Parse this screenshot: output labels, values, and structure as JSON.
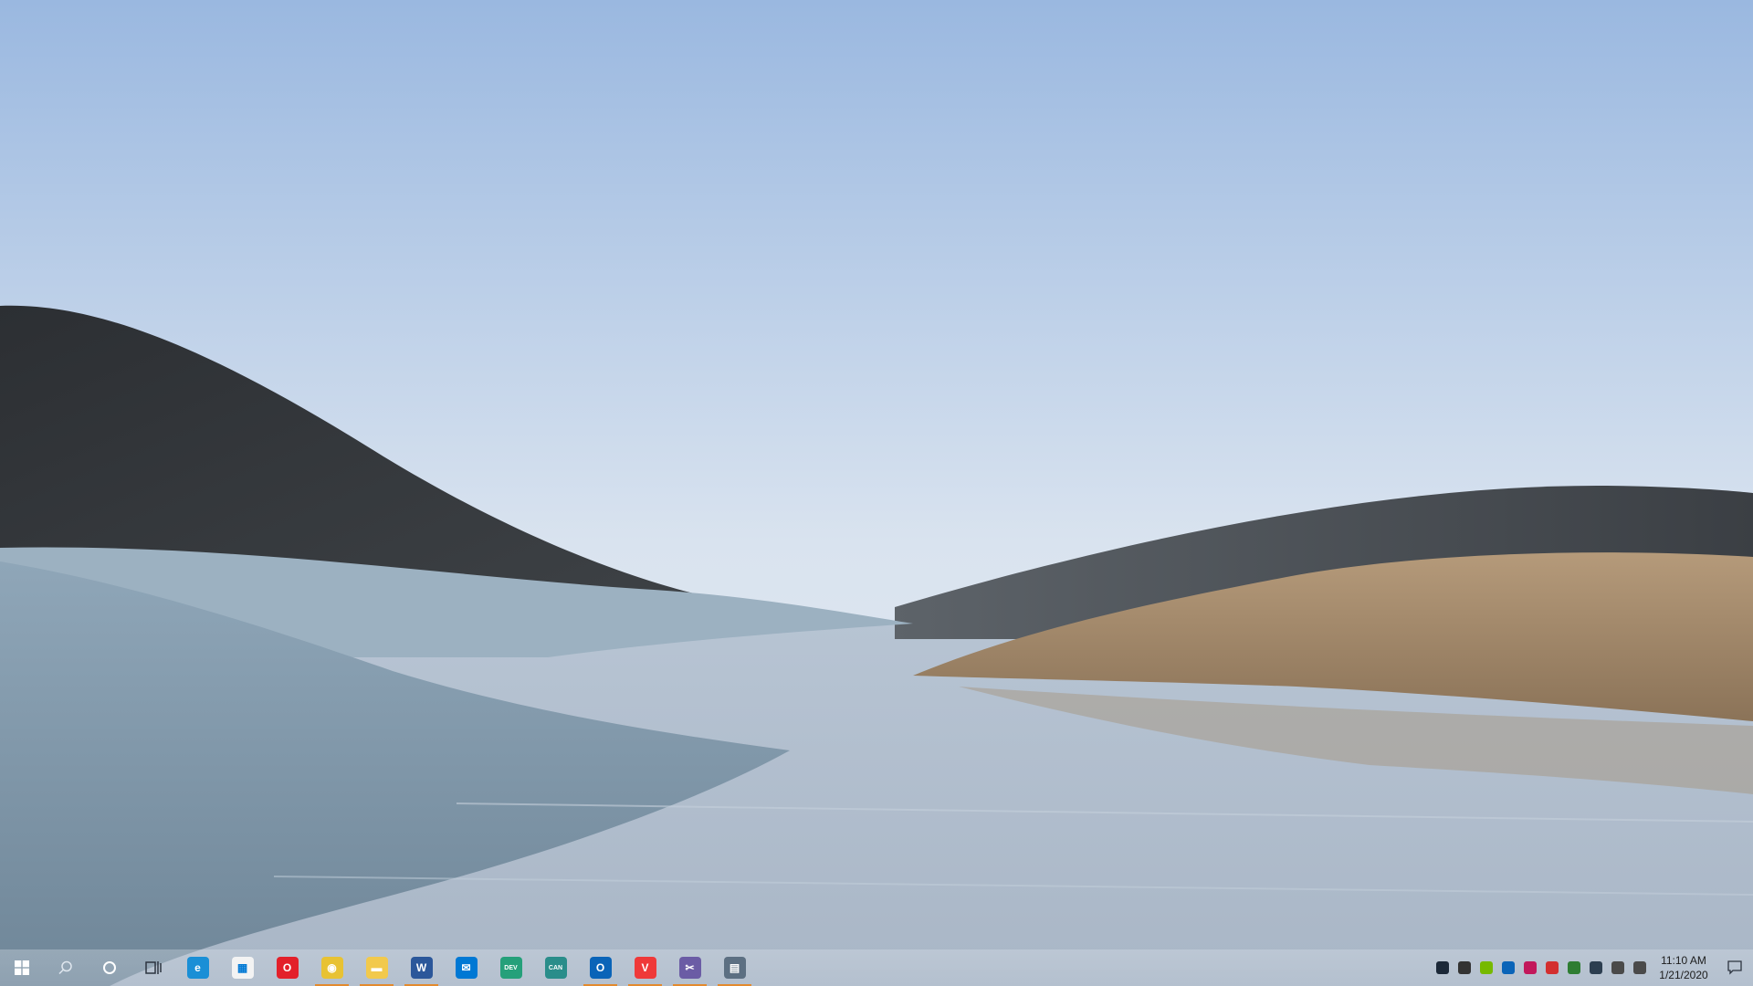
{
  "desktop": {
    "wallpaper": "Windows 10 landscape: hills, grass and water"
  },
  "taskbar": {
    "start_icon": "windows-logo-icon",
    "search_icon": "search-icon",
    "cortana_icon": "cortana-ring-icon",
    "task_view_icon": "task-view-icon",
    "apps": [
      {
        "name": "edge-icon",
        "color": "#1a8fd6",
        "glyph": "e",
        "running": false
      },
      {
        "name": "microsoft-store-icon",
        "color": "#f3f3f3",
        "glyph": "▦",
        "running": false
      },
      {
        "name": "opera-icon",
        "color": "#e3202a",
        "glyph": "O",
        "running": false
      },
      {
        "name": "chrome-icon",
        "color": "#e8c233",
        "glyph": "◉",
        "running": true
      },
      {
        "name": "file-explorer-icon",
        "color": "#f2c94c",
        "glyph": "▬",
        "running": true
      },
      {
        "name": "word-icon",
        "color": "#2b579a",
        "glyph": "W",
        "running": true
      },
      {
        "name": "mail-icon",
        "color": "#0078d4",
        "glyph": "✉",
        "running": false
      },
      {
        "name": "edge-dev-icon",
        "color": "#25a07a",
        "glyph": "DEV",
        "running": false
      },
      {
        "name": "edge-canary-icon",
        "color": "#2a8d8a",
        "glyph": "CAN",
        "running": false
      },
      {
        "name": "outlook-icon",
        "color": "#0a64b8",
        "glyph": "O",
        "running": true
      },
      {
        "name": "vivaldi-icon",
        "color": "#ef3939",
        "glyph": "V",
        "running": true
      },
      {
        "name": "snip-tool-icon",
        "color": "#6b5ca5",
        "glyph": "✂",
        "running": true
      },
      {
        "name": "news-icon",
        "color": "#5c6f82",
        "glyph": "▤",
        "running": true
      }
    ],
    "tray_icons": [
      {
        "name": "steam-tray-icon",
        "color": "#1b2838"
      },
      {
        "name": "printer-tray-icon",
        "color": "#333333"
      },
      {
        "name": "nvidia-tray-icon",
        "color": "#76b900"
      },
      {
        "name": "outlook-tray-icon",
        "color": "#0a64b8"
      },
      {
        "name": "paint-tray-icon",
        "color": "#c2185b"
      },
      {
        "name": "screenshot-tray-icon",
        "color": "#d32f2f"
      },
      {
        "name": "security-tray-icon",
        "color": "#2e7d32"
      },
      {
        "name": "shield-tray-icon",
        "color": "#2c3e50"
      },
      {
        "name": "network-tray-icon",
        "color": "#4a4a4a"
      },
      {
        "name": "volume-muted-tray-icon",
        "color": "#4a4a4a"
      }
    ],
    "clock": {
      "time": "11:10 AM",
      "date": "1/21/2020"
    },
    "notifications_icon": "action-center-icon"
  }
}
